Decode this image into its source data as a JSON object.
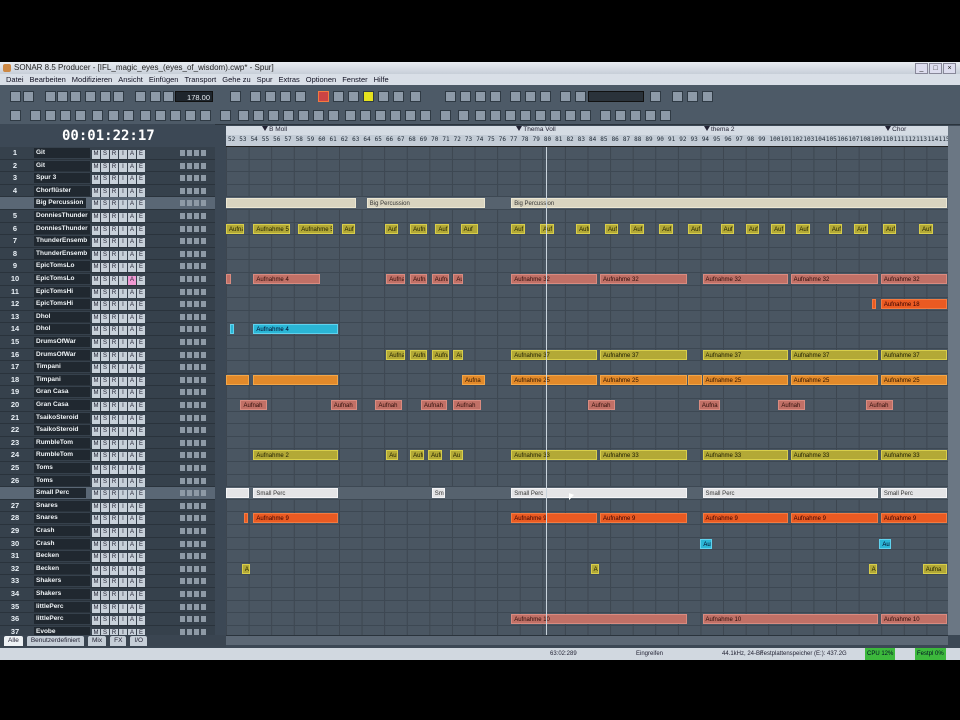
{
  "window": {
    "title": "SONAR 8.5 Producer - [IFL_magic_eyes_(eyes_of_wisdom).cwp* - Spur]"
  },
  "menu": [
    "Datei",
    "Bearbeiten",
    "Modifizieren",
    "Ansicht",
    "Einfügen",
    "Transport",
    "Gehe zu",
    "Spur",
    "Extras",
    "Optionen",
    "Fenster",
    "Hilfe"
  ],
  "toolbar": {
    "tempo": "178.00"
  },
  "now_time": "00:01:22:17",
  "markers": [
    {
      "label": "B Moll",
      "pos": 0.05
    },
    {
      "label": "Thema Voll",
      "pos": 0.402
    },
    {
      "label": "thema 2",
      "pos": 0.662
    },
    {
      "label": "Chor",
      "pos": 0.913
    }
  ],
  "measures_start": 52,
  "measures_end": 115,
  "track_buttons": [
    "M",
    "S",
    "R",
    "I",
    "A",
    "E"
  ],
  "tracks": [
    {
      "num": "1",
      "name": "Git"
    },
    {
      "num": "2",
      "name": "Git"
    },
    {
      "num": "3",
      "name": "Spur 3"
    },
    {
      "num": "4",
      "name": "Chorflüster"
    },
    {
      "num": "",
      "name": "Big Percussion",
      "folder": true
    },
    {
      "num": "5",
      "name": "DonniesThunder"
    },
    {
      "num": "6",
      "name": "DonniesThunder"
    },
    {
      "num": "7",
      "name": "ThunderEnsemb"
    },
    {
      "num": "8",
      "name": "ThunderEnsemb"
    },
    {
      "num": "9",
      "name": "EpicTomsLo"
    },
    {
      "num": "10",
      "name": "EpicTomsLo",
      "pink": true
    },
    {
      "num": "11",
      "name": "EpicTomsHi"
    },
    {
      "num": "12",
      "name": "EpicTomsHi"
    },
    {
      "num": "13",
      "name": "Dhol"
    },
    {
      "num": "14",
      "name": "Dhol"
    },
    {
      "num": "15",
      "name": "DrumsOfWar"
    },
    {
      "num": "16",
      "name": "DrumsOfWar"
    },
    {
      "num": "17",
      "name": "Timpani"
    },
    {
      "num": "18",
      "name": "Timpani"
    },
    {
      "num": "19",
      "name": "Gran Casa"
    },
    {
      "num": "20",
      "name": "Gran Casa"
    },
    {
      "num": "21",
      "name": "TsaikoSteroid"
    },
    {
      "num": "22",
      "name": "TsaikoSteroid"
    },
    {
      "num": "23",
      "name": "RumbleTom"
    },
    {
      "num": "24",
      "name": "RumbleTom"
    },
    {
      "num": "25",
      "name": "Toms"
    },
    {
      "num": "26",
      "name": "Toms"
    },
    {
      "num": "",
      "name": "Small Perc",
      "folder": true
    },
    {
      "num": "27",
      "name": "Snares"
    },
    {
      "num": "28",
      "name": "Snares"
    },
    {
      "num": "29",
      "name": "Crash"
    },
    {
      "num": "30",
      "name": "Crash"
    },
    {
      "num": "31",
      "name": "Becken"
    },
    {
      "num": "32",
      "name": "Becken"
    },
    {
      "num": "33",
      "name": "Shakers"
    },
    {
      "num": "34",
      "name": "Shakers"
    },
    {
      "num": "35",
      "name": "littlePerc"
    },
    {
      "num": "36",
      "name": "littlePerc"
    },
    {
      "num": "37",
      "name": "Evobe"
    }
  ],
  "clips": [
    {
      "row": 4,
      "cls": "bigp",
      "a": 0.0,
      "b": 0.182,
      "label": ""
    },
    {
      "row": 4,
      "cls": "bigp",
      "a": 0.195,
      "b": 0.36,
      "label": "Big Percussion"
    },
    {
      "row": 4,
      "cls": "bigp",
      "a": 0.395,
      "b": 1.0,
      "label": "Big Percussion"
    },
    {
      "row": 6,
      "cls": "yel",
      "a": 0.0,
      "b": 0.026,
      "label": "Aufnahme"
    },
    {
      "row": 6,
      "cls": "yel",
      "a": 0.038,
      "b": 0.09,
      "label": "Aufnahme 5"
    },
    {
      "row": 6,
      "cls": "yel",
      "a": 0.1,
      "b": 0.15,
      "label": "Aufnahme 5"
    },
    {
      "row": 6,
      "cls": "yel",
      "a": 0.16,
      "b": 0.18,
      "label": "Aufn"
    },
    {
      "row": 6,
      "cls": "yel",
      "a": 0.22,
      "b": 0.24,
      "label": "Aufn"
    },
    {
      "row": 6,
      "cls": "yel",
      "a": 0.255,
      "b": 0.28,
      "label": "Aufn"
    },
    {
      "row": 6,
      "cls": "yel",
      "a": 0.29,
      "b": 0.31,
      "label": "Auf"
    },
    {
      "row": 6,
      "cls": "yel",
      "a": 0.325,
      "b": 0.35,
      "label": "Auf"
    },
    {
      "row": 6,
      "cls": "yel",
      "a": 0.395,
      "b": 0.415,
      "label": "Auf"
    },
    {
      "row": 6,
      "cls": "yel",
      "a": 0.435,
      "b": 0.455,
      "label": "Auf"
    },
    {
      "row": 6,
      "cls": "yel",
      "a": 0.485,
      "b": 0.505,
      "label": "Aufn"
    },
    {
      "row": 6,
      "cls": "yel",
      "a": 0.525,
      "b": 0.545,
      "label": "Auf"
    },
    {
      "row": 6,
      "cls": "yel",
      "a": 0.56,
      "b": 0.58,
      "label": "Auf"
    },
    {
      "row": 6,
      "cls": "yel",
      "a": 0.6,
      "b": 0.62,
      "label": "Auf"
    },
    {
      "row": 6,
      "cls": "yel",
      "a": 0.64,
      "b": 0.66,
      "label": "Auf"
    },
    {
      "row": 6,
      "cls": "yel",
      "a": 0.685,
      "b": 0.705,
      "label": "Auf"
    },
    {
      "row": 6,
      "cls": "yel",
      "a": 0.72,
      "b": 0.74,
      "label": "Auf"
    },
    {
      "row": 6,
      "cls": "yel",
      "a": 0.755,
      "b": 0.775,
      "label": "Auf"
    },
    {
      "row": 6,
      "cls": "yel",
      "a": 0.79,
      "b": 0.81,
      "label": "Auf"
    },
    {
      "row": 6,
      "cls": "yel",
      "a": 0.835,
      "b": 0.855,
      "label": "Auf"
    },
    {
      "row": 6,
      "cls": "yel",
      "a": 0.87,
      "b": 0.89,
      "label": "Auf"
    },
    {
      "row": 6,
      "cls": "yel",
      "a": 0.91,
      "b": 0.93,
      "label": "Auf"
    },
    {
      "row": 6,
      "cls": "yel",
      "a": 0.96,
      "b": 0.98,
      "label": "Auf"
    },
    {
      "row": 10,
      "cls": "sal",
      "a": 0.0,
      "b": 0.008,
      "label": ""
    },
    {
      "row": 10,
      "cls": "sal",
      "a": 0.038,
      "b": 0.132,
      "label": "Aufnahme 4"
    },
    {
      "row": 10,
      "cls": "sal",
      "a": 0.222,
      "b": 0.25,
      "label": "Aufna"
    },
    {
      "row": 10,
      "cls": "sal",
      "a": 0.255,
      "b": 0.28,
      "label": "Aufna"
    },
    {
      "row": 10,
      "cls": "sal",
      "a": 0.285,
      "b": 0.31,
      "label": "Aufna"
    },
    {
      "row": 10,
      "cls": "sal",
      "a": 0.315,
      "b": 0.33,
      "label": "Au"
    },
    {
      "row": 10,
      "cls": "sal",
      "a": 0.395,
      "b": 0.515,
      "label": "Aufnahme 32"
    },
    {
      "row": 10,
      "cls": "sal",
      "a": 0.518,
      "b": 0.64,
      "label": "Aufnahme 32"
    },
    {
      "row": 10,
      "cls": "sal",
      "a": 0.66,
      "b": 0.78,
      "label": "Aufnahme 32"
    },
    {
      "row": 10,
      "cls": "sal",
      "a": 0.782,
      "b": 0.905,
      "label": "Aufnahme 32"
    },
    {
      "row": 10,
      "cls": "sal",
      "a": 0.907,
      "b": 1.0,
      "label": "Aufnahme 32"
    },
    {
      "row": 12,
      "cls": "red",
      "a": 0.895,
      "b": 0.9,
      "label": ""
    },
    {
      "row": 12,
      "cls": "red",
      "a": 0.907,
      "b": 1.0,
      "label": "Aufnahme 18"
    },
    {
      "row": 14,
      "cls": "cyan",
      "a": 0.006,
      "b": 0.01,
      "label": ""
    },
    {
      "row": 14,
      "cls": "cyan",
      "a": 0.038,
      "b": 0.157,
      "label": "Aufnahme 4"
    },
    {
      "row": 16,
      "cls": "yel",
      "a": 0.222,
      "b": 0.25,
      "label": "Aufna"
    },
    {
      "row": 16,
      "cls": "yel",
      "a": 0.255,
      "b": 0.28,
      "label": "Aufna"
    },
    {
      "row": 16,
      "cls": "yel",
      "a": 0.285,
      "b": 0.31,
      "label": "Aufna"
    },
    {
      "row": 16,
      "cls": "yel",
      "a": 0.315,
      "b": 0.33,
      "label": "Au"
    },
    {
      "row": 16,
      "cls": "yel",
      "a": 0.395,
      "b": 0.515,
      "label": "Aufnahme 37"
    },
    {
      "row": 16,
      "cls": "yel",
      "a": 0.518,
      "b": 0.64,
      "label": "Aufnahme 37"
    },
    {
      "row": 16,
      "cls": "yel",
      "a": 0.66,
      "b": 0.78,
      "label": "Aufnahme 37"
    },
    {
      "row": 16,
      "cls": "yel",
      "a": 0.782,
      "b": 0.905,
      "label": "Aufnahme 37"
    },
    {
      "row": 16,
      "cls": "yel",
      "a": 0.907,
      "b": 1.0,
      "label": "Aufnahme 37"
    },
    {
      "row": 18,
      "cls": "org",
      "a": 0.0,
      "b": 0.033,
      "label": ""
    },
    {
      "row": 18,
      "cls": "org",
      "a": 0.038,
      "b": 0.157,
      "label": ""
    },
    {
      "row": 18,
      "cls": "org",
      "a": 0.327,
      "b": 0.36,
      "label": "Aufna"
    },
    {
      "row": 18,
      "cls": "org",
      "a": 0.395,
      "b": 0.515,
      "label": "Aufnahme 25"
    },
    {
      "row": 18,
      "cls": "org",
      "a": 0.518,
      "b": 0.64,
      "label": "Aufnahme 25"
    },
    {
      "row": 18,
      "cls": "org",
      "a": 0.64,
      "b": 0.66,
      "label": ""
    },
    {
      "row": 18,
      "cls": "org",
      "a": 0.66,
      "b": 0.78,
      "label": "Aufnahme 25"
    },
    {
      "row": 18,
      "cls": "org",
      "a": 0.782,
      "b": 0.905,
      "label": "Aufnahme 25"
    },
    {
      "row": 18,
      "cls": "org",
      "a": 0.907,
      "b": 1.0,
      "label": "Aufnahme 25"
    },
    {
      "row": 20,
      "cls": "sal",
      "a": 0.02,
      "b": 0.058,
      "label": "Aufnah"
    },
    {
      "row": 20,
      "cls": "sal",
      "a": 0.145,
      "b": 0.183,
      "label": "Aufnah"
    },
    {
      "row": 20,
      "cls": "sal",
      "a": 0.207,
      "b": 0.245,
      "label": "Aufnah"
    },
    {
      "row": 20,
      "cls": "sal",
      "a": 0.27,
      "b": 0.308,
      "label": "Aufnah"
    },
    {
      "row": 20,
      "cls": "sal",
      "a": 0.315,
      "b": 0.355,
      "label": "Aufnah"
    },
    {
      "row": 20,
      "cls": "sal",
      "a": 0.502,
      "b": 0.54,
      "label": "Aufnah"
    },
    {
      "row": 20,
      "cls": "sal",
      "a": 0.655,
      "b": 0.685,
      "label": "Aufna"
    },
    {
      "row": 20,
      "cls": "sal",
      "a": 0.765,
      "b": 0.803,
      "label": "Aufnah"
    },
    {
      "row": 20,
      "cls": "sal",
      "a": 0.887,
      "b": 0.925,
      "label": "Aufnah"
    },
    {
      "row": 24,
      "cls": "yel",
      "a": 0.038,
      "b": 0.157,
      "label": "Aufnahme 2"
    },
    {
      "row": 24,
      "cls": "yel",
      "a": 0.222,
      "b": 0.24,
      "label": "Aufr"
    },
    {
      "row": 24,
      "cls": "yel",
      "a": 0.255,
      "b": 0.275,
      "label": "Aufr"
    },
    {
      "row": 24,
      "cls": "yel",
      "a": 0.28,
      "b": 0.3,
      "label": "Aufr"
    },
    {
      "row": 24,
      "cls": "yel",
      "a": 0.31,
      "b": 0.33,
      "label": "Au"
    },
    {
      "row": 24,
      "cls": "yel",
      "a": 0.395,
      "b": 0.515,
      "label": "Aufnahme 33"
    },
    {
      "row": 24,
      "cls": "yel",
      "a": 0.518,
      "b": 0.64,
      "label": "Aufnahme 33"
    },
    {
      "row": 24,
      "cls": "yel",
      "a": 0.66,
      "b": 0.78,
      "label": "Aufnahme 33"
    },
    {
      "row": 24,
      "cls": "yel",
      "a": 0.782,
      "b": 0.905,
      "label": "Aufnahme 33"
    },
    {
      "row": 24,
      "cls": "yel",
      "a": 0.907,
      "b": 1.0,
      "label": "Aufnahme 33"
    },
    {
      "row": 27,
      "cls": "smallp",
      "a": 0.0,
      "b": 0.033,
      "label": ""
    },
    {
      "row": 27,
      "cls": "smallp",
      "a": 0.038,
      "b": 0.157,
      "label": "Small Perc"
    },
    {
      "row": 27,
      "cls": "smallp",
      "a": 0.285,
      "b": 0.305,
      "label": "Sma"
    },
    {
      "row": 27,
      "cls": "smallp",
      "a": 0.395,
      "b": 0.64,
      "label": "Small Perc"
    },
    {
      "row": 27,
      "cls": "smallp",
      "a": 0.66,
      "b": 0.905,
      "label": "Small Perc"
    },
    {
      "row": 27,
      "cls": "smallp",
      "a": 0.907,
      "b": 1.0,
      "label": "Small Perc"
    },
    {
      "row": 29,
      "cls": "red",
      "a": 0.025,
      "b": 0.03,
      "label": ""
    },
    {
      "row": 29,
      "cls": "red",
      "a": 0.038,
      "b": 0.157,
      "label": "Aufnahme 9"
    },
    {
      "row": 29,
      "cls": "red",
      "a": 0.395,
      "b": 0.515,
      "label": "Aufnahme 9"
    },
    {
      "row": 29,
      "cls": "red",
      "a": 0.518,
      "b": 0.64,
      "label": "Aufnahme 9"
    },
    {
      "row": 29,
      "cls": "red",
      "a": 0.66,
      "b": 0.78,
      "label": "Aufnahme 9"
    },
    {
      "row": 29,
      "cls": "red",
      "a": 0.782,
      "b": 0.905,
      "label": "Aufnahme 9"
    },
    {
      "row": 29,
      "cls": "red",
      "a": 0.907,
      "b": 1.0,
      "label": "Aufnahme 9"
    },
    {
      "row": 31,
      "cls": "cyan",
      "a": 0.657,
      "b": 0.675,
      "label": "Auf"
    },
    {
      "row": 31,
      "cls": "cyan",
      "a": 0.905,
      "b": 0.923,
      "label": "Auf"
    },
    {
      "row": 33,
      "cls": "yel",
      "a": 0.022,
      "b": 0.035,
      "label": "A"
    },
    {
      "row": 33,
      "cls": "yel",
      "a": 0.505,
      "b": 0.518,
      "label": "A"
    },
    {
      "row": 33,
      "cls": "yel",
      "a": 0.89,
      "b": 0.903,
      "label": "A"
    },
    {
      "row": 33,
      "cls": "yel",
      "a": 0.965,
      "b": 1.0,
      "label": "Aufna"
    },
    {
      "row": 37,
      "cls": "sal",
      "a": 0.395,
      "b": 0.64,
      "label": "Aufnahme 10"
    },
    {
      "row": 37,
      "cls": "sal",
      "a": 0.66,
      "b": 0.905,
      "label": "Aufnahme 10"
    },
    {
      "row": 37,
      "cls": "sal",
      "a": 0.907,
      "b": 1.0,
      "label": "Aufnahme 10"
    }
  ],
  "tabs": [
    "Alle",
    "Benutzerdefiniert",
    "Mix",
    "FX",
    "I/O"
  ],
  "status": {
    "time": "63:02:289",
    "mode": "Eingreifen",
    "format": "44.1kHz, 24-Bit",
    "disk": "Festplattenspeicher (E:): 437.2G",
    "cpu": "CPU 12%",
    "disk_pct": "Festpl 0%"
  },
  "colors": {
    "yellow": "#b3a936",
    "salmon": "#c17066",
    "orange": "#e38a2a",
    "red": "#ea5a22",
    "cyan": "#2ab6d6"
  }
}
